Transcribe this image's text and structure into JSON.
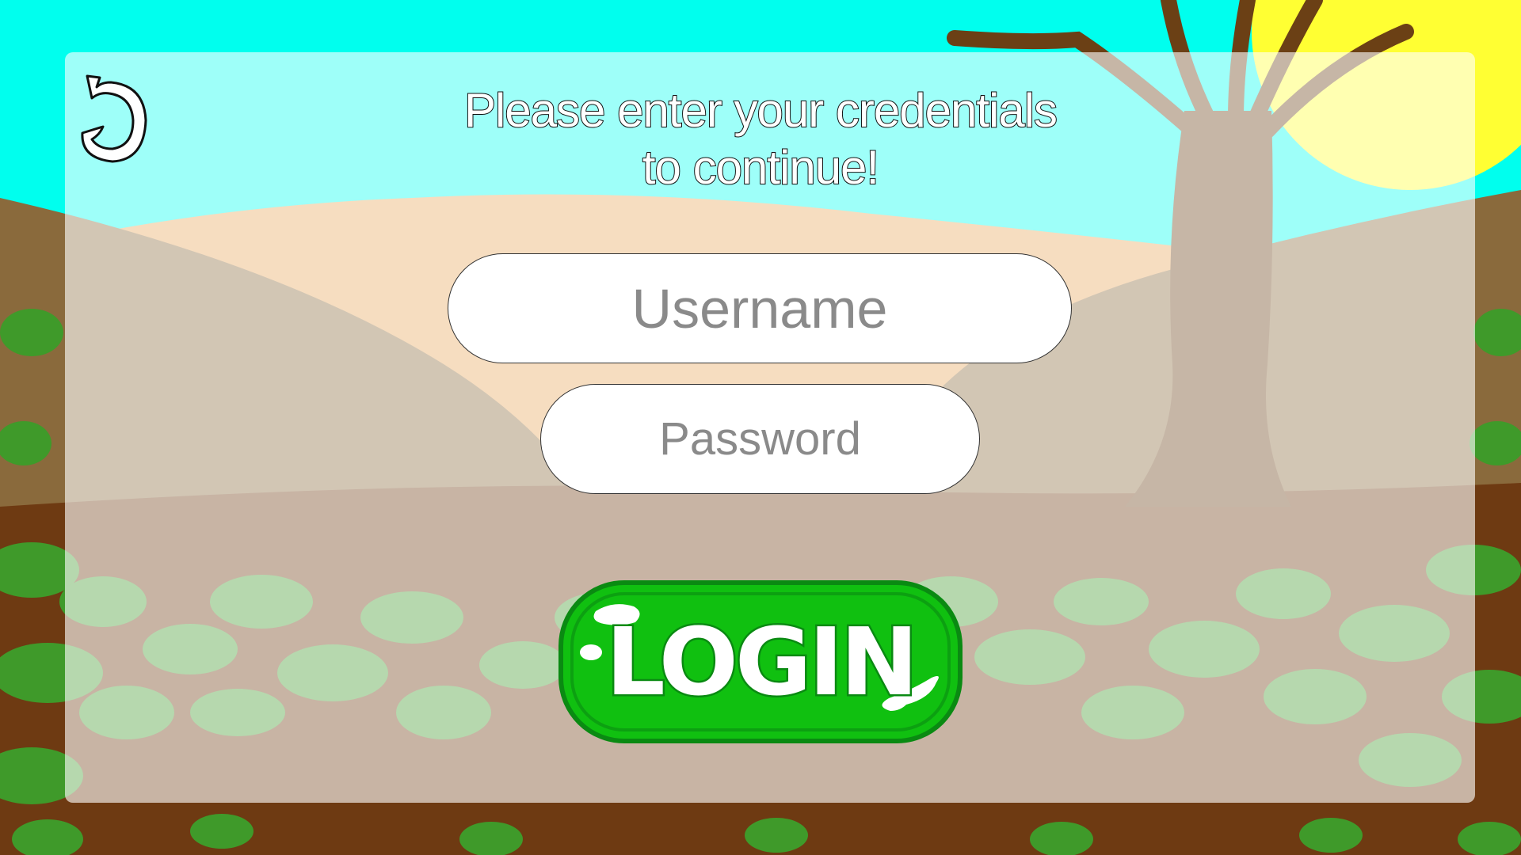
{
  "screen": {
    "prompt_line1": "Please enter your credentials",
    "prompt_line2": "to continue!"
  },
  "form": {
    "username_placeholder": "Username",
    "password_placeholder": "Password",
    "login_label": "LOGIN"
  },
  "icons": {
    "back": "curved-back-arrow-icon"
  },
  "colors": {
    "sky": "#00ffee",
    "sun": "#ffff33",
    "hill_far": "#e8a65a",
    "hill_near": "#8a6a3c",
    "ground": "#6e3a12",
    "foliage": "#3f9a2a",
    "tree": "#6b4015",
    "login_green": "#10c010",
    "login_dark": "#0a8a12",
    "panel_overlay": "rgba(255,255,255,0.62)"
  }
}
